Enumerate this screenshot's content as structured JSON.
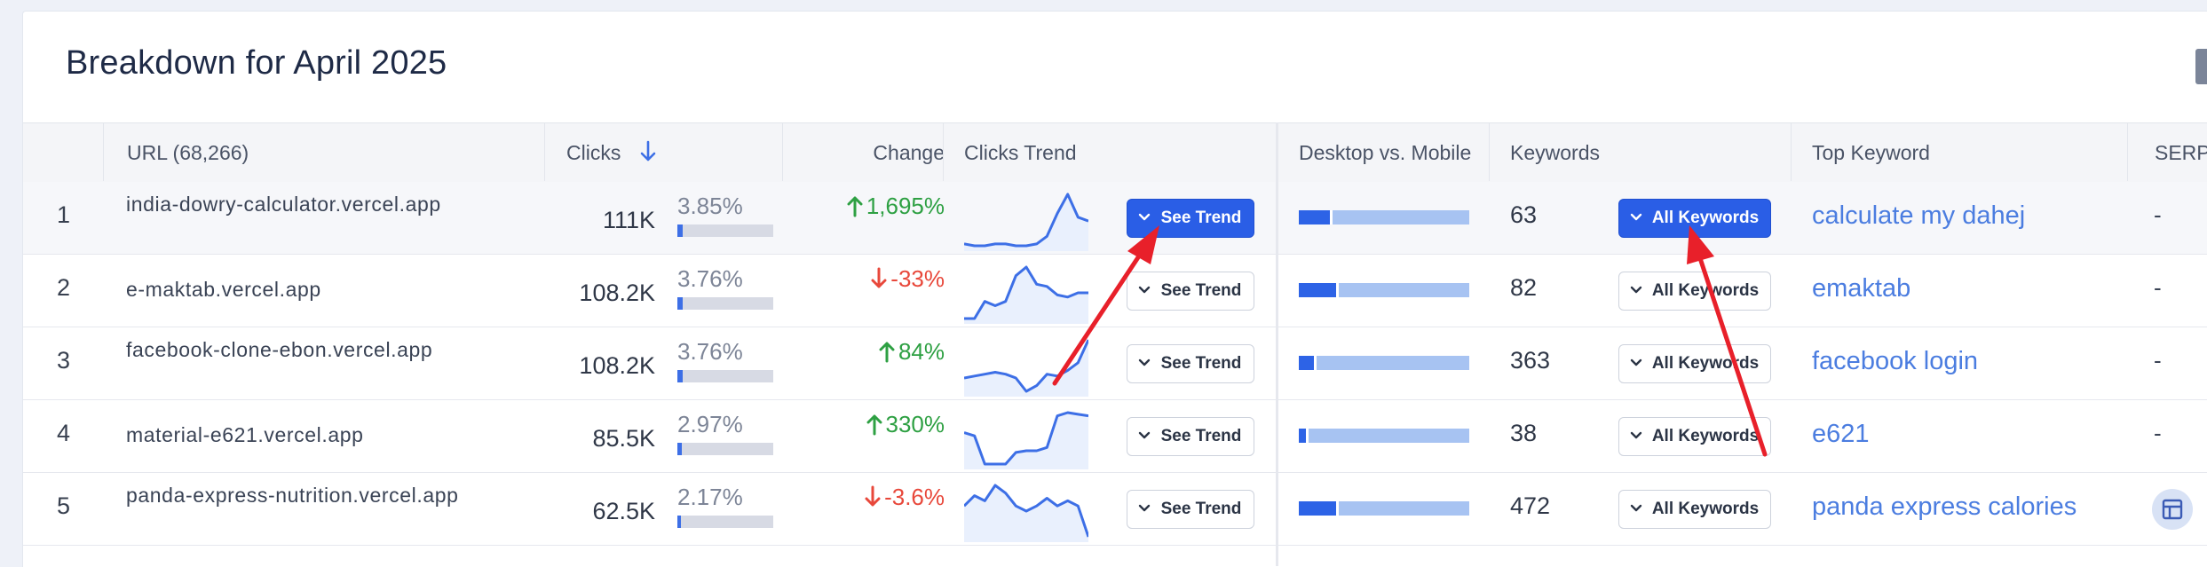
{
  "title": "Breakdown for April 2025",
  "headers": {
    "url": "URL (68,266)",
    "clicks": "Clicks",
    "change": "Change",
    "clicks_trend": "Clicks Trend",
    "desktop_mobile": "Desktop vs. Mobile",
    "keywords": "Keywords",
    "top_keyword": "Top Keyword",
    "serp": "SERP"
  },
  "sort_icon": "arrow-down-icon",
  "colors": {
    "accent": "#2a5ee6",
    "up": "#2ea043",
    "down": "#e8483b",
    "link": "#4b7de0",
    "annotation": "#e8202a"
  },
  "rows": [
    {
      "rank": "1",
      "url": "india-dowry-calculator.vercel.app",
      "clicks": "111K",
      "pct": "3.85%",
      "pct_value": 3.85,
      "change": "1,695%",
      "direction": "up",
      "trend_button": "See Trend",
      "trend_primary": true,
      "desktop_share": 0.18,
      "keywords": "63",
      "keywords_button": "All Keywords",
      "keywords_primary": true,
      "top_keyword": "calculate my dahej",
      "serp": "-",
      "trend": [
        4,
        3,
        3,
        4,
        4,
        3,
        3,
        4,
        8,
        20,
        30,
        18,
        16
      ]
    },
    {
      "rank": "2",
      "url": "e-maktab.vercel.app",
      "clicks": "108.2K",
      "pct": "3.76%",
      "pct_value": 3.76,
      "change": "-33%",
      "direction": "down",
      "trend_button": "See Trend",
      "trend_primary": false,
      "desktop_share": 0.22,
      "keywords": "82",
      "keywords_button": "All Keywords",
      "keywords_primary": false,
      "top_keyword": "emaktab",
      "serp": "-",
      "trend": [
        4,
        4,
        12,
        10,
        12,
        24,
        28,
        20,
        19,
        15,
        14,
        16,
        16
      ]
    },
    {
      "rank": "3",
      "url": "facebook-clone-ebon.vercel.app",
      "clicks": "108.2K",
      "pct": "3.76%",
      "pct_value": 3.76,
      "change": "84%",
      "direction": "up",
      "trend_button": "See Trend",
      "trend_primary": false,
      "desktop_share": 0.09,
      "keywords": "363",
      "keywords_button": "All Keywords",
      "keywords_primary": false,
      "top_keyword": "facebook login",
      "serp": "-",
      "trend": [
        12,
        13,
        14,
        15,
        14,
        12,
        5,
        8,
        14,
        13,
        16,
        20,
        32
      ]
    },
    {
      "rank": "4",
      "url": "material-e621.vercel.app",
      "clicks": "85.5K",
      "pct": "2.97%",
      "pct_value": 2.97,
      "change": "330%",
      "direction": "up",
      "trend_button": "See Trend",
      "trend_primary": false,
      "desktop_share": 0.04,
      "keywords": "38",
      "keywords_button": "All Keywords",
      "keywords_primary": false,
      "top_keyword": "e621",
      "serp": "-",
      "trend": [
        24,
        22,
        5,
        5,
        5,
        12,
        13,
        13,
        15,
        34,
        36,
        35,
        34
      ]
    },
    {
      "rank": "5",
      "url": "panda-express-nutrition.vercel.app",
      "clicks": "62.5K",
      "pct": "2.17%",
      "pct_value": 2.17,
      "change": "-3.6%",
      "direction": "down",
      "trend_button": "See Trend",
      "trend_primary": false,
      "desktop_share": 0.22,
      "keywords": "472",
      "keywords_button": "All Keywords",
      "keywords_primary": false,
      "top_keyword": "panda express calories",
      "serp": "",
      "serp_icon": "table-icon",
      "trend": [
        22,
        26,
        24,
        30,
        27,
        22,
        20,
        22,
        25,
        22,
        24,
        22,
        10
      ]
    }
  ]
}
